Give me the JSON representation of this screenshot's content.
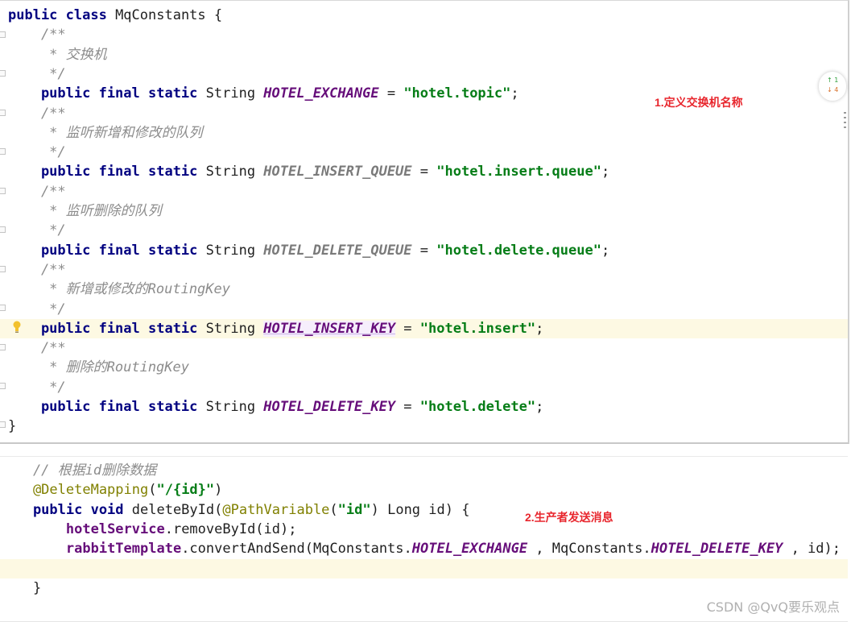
{
  "snippet1": {
    "lines": [
      [
        {
          "t": "public class ",
          "c": "kw"
        },
        {
          "t": "MqConstants {",
          "c": "ty"
        }
      ],
      [
        {
          "t": "    /**",
          "c": "cmt"
        }
      ],
      [
        {
          "t": "     * 交换机",
          "c": "cmt"
        }
      ],
      [
        {
          "t": "     */",
          "c": "cmt"
        }
      ],
      [
        {
          "t": "    public final static ",
          "c": "kw"
        },
        {
          "t": "String ",
          "c": "ty"
        },
        {
          "t": "HOTEL_EXCHANGE",
          "c": "cst"
        },
        {
          "t": " = ",
          "c": "ty"
        },
        {
          "t": "\"hotel.topic\"",
          "c": "str"
        },
        {
          "t": ";",
          "c": "ty"
        }
      ],
      [
        {
          "t": "    /**",
          "c": "cmt"
        }
      ],
      [
        {
          "t": "     * 监听新增和修改的队列",
          "c": "cmt"
        }
      ],
      [
        {
          "t": "     */",
          "c": "cmt"
        }
      ],
      [
        {
          "t": "    public final static ",
          "c": "kw"
        },
        {
          "t": "String ",
          "c": "ty"
        },
        {
          "t": "HOTEL_INSERT_QUEUE",
          "c": "cst-gray"
        },
        {
          "t": " = ",
          "c": "ty"
        },
        {
          "t": "\"hotel.insert.queue\"",
          "c": "str"
        },
        {
          "t": ";",
          "c": "ty"
        }
      ],
      [
        {
          "t": "    /**",
          "c": "cmt"
        }
      ],
      [
        {
          "t": "     * 监听删除的队列",
          "c": "cmt"
        }
      ],
      [
        {
          "t": "     */",
          "c": "cmt"
        }
      ],
      [
        {
          "t": "    public final static ",
          "c": "kw"
        },
        {
          "t": "String ",
          "c": "ty"
        },
        {
          "t": "HOTEL_DELETE_QUEUE",
          "c": "cst-gray"
        },
        {
          "t": " = ",
          "c": "ty"
        },
        {
          "t": "\"hotel.delete.queue\"",
          "c": "str"
        },
        {
          "t": ";",
          "c": "ty"
        }
      ],
      [
        {
          "t": "    /**",
          "c": "cmt"
        }
      ],
      [
        {
          "t": "     * 新增或修改的RoutingKey",
          "c": "cmt"
        }
      ],
      [
        {
          "t": "     */",
          "c": "cmt"
        }
      ],
      [
        {
          "t": "    public final static ",
          "c": "kw"
        },
        {
          "t": "String ",
          "c": "ty"
        },
        {
          "t": "HOTEL_INSERT_KEY",
          "c": "cst key-under",
          "caret": true
        },
        {
          "t": " = ",
          "c": "ty"
        },
        {
          "t": "\"hotel.insert\"",
          "c": "str"
        },
        {
          "t": ";",
          "c": "ty"
        }
      ],
      [
        {
          "t": "    /**",
          "c": "cmt"
        }
      ],
      [
        {
          "t": "     * 删除的RoutingKey",
          "c": "cmt"
        }
      ],
      [
        {
          "t": "     */",
          "c": "cmt"
        }
      ],
      [
        {
          "t": "    public final static ",
          "c": "kw"
        },
        {
          "t": "String ",
          "c": "ty"
        },
        {
          "t": "HOTEL_DELETE_KEY",
          "c": "cst"
        },
        {
          "t": " = ",
          "c": "ty"
        },
        {
          "t": "\"hotel.delete\"",
          "c": "str"
        },
        {
          "t": ";",
          "c": "ty"
        }
      ],
      [
        {
          "t": "}",
          "c": "ty"
        }
      ]
    ],
    "note": "1.定义交换机名称",
    "vcs_badge": {
      "up": "↑ 1",
      "down": "↓ 4"
    }
  },
  "snippet2": {
    "lines": [
      [
        {
          "t": "    // 根据",
          "c": "cmt"
        },
        {
          "t": "id",
          "c": "cmt"
        },
        {
          "t": "删除数据",
          "c": "cmt"
        }
      ],
      [
        {
          "t": "    @DeleteMapping",
          "c": "ann"
        },
        {
          "t": "(",
          "c": "ty"
        },
        {
          "t": "\"/{id}\"",
          "c": "str"
        },
        {
          "t": ")",
          "c": "ty"
        }
      ],
      [
        {
          "t": "    public void ",
          "c": "kw"
        },
        {
          "t": "deleteById(",
          "c": "ty"
        },
        {
          "t": "@PathVariable",
          "c": "ann"
        },
        {
          "t": "(",
          "c": "ty"
        },
        {
          "t": "\"id\"",
          "c": "str"
        },
        {
          "t": ") Long id) {",
          "c": "ty"
        }
      ],
      [
        {
          "t": "        ",
          "c": "ty"
        },
        {
          "t": "hotelService",
          "c": "fld"
        },
        {
          "t": ".removeById(id);",
          "c": "ty"
        }
      ],
      [
        {
          "t": "        ",
          "c": "ty"
        },
        {
          "t": "rabbitTemplate",
          "c": "fld"
        },
        {
          "t": ".convertAndSend(MqConstants.",
          "c": "ty"
        },
        {
          "t": "HOTEL_EXCHANGE",
          "c": "cst"
        },
        {
          "t": " , MqConstants.",
          "c": "ty"
        },
        {
          "t": "HOTEL_DELETE_KEY",
          "c": "cst"
        },
        {
          "t": " , id);",
          "c": "ty"
        }
      ],
      [
        {
          "t": "",
          "c": "ty"
        }
      ],
      [
        {
          "t": "    }",
          "c": "ty"
        }
      ]
    ],
    "note": "2.生产者发送消息"
  },
  "watermark": "CSDN @QvQ要乐观点"
}
